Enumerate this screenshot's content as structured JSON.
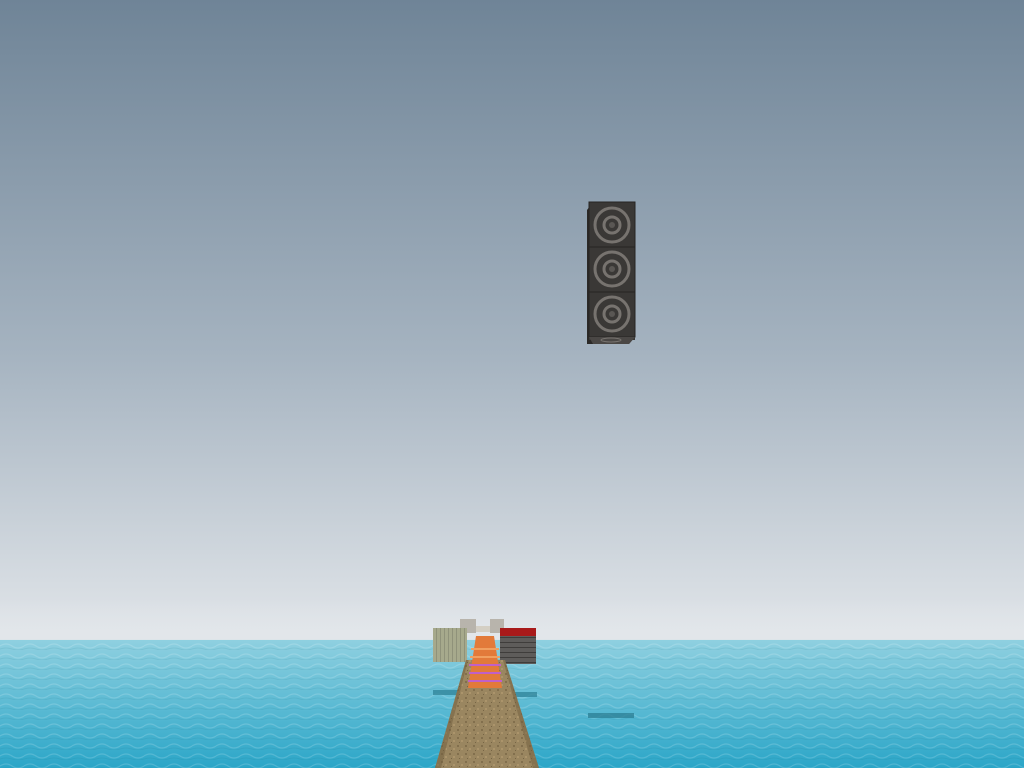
{
  "scene": {
    "colors": {
      "sky_top": "#6f8497",
      "sky_mid": "#a5b3c0",
      "sky_horizon": "#e2e6ea",
      "water_far": "#8fd0e0",
      "water_near": "#2ba6c8",
      "water_shadow": "#2b7d93",
      "path_dirt": "#9a8660",
      "path_dirt_dark": "#7c6a48",
      "speaker_block_dark": "#3a3836",
      "speaker_block_light": "#5a5754",
      "speaker_ring": "#77736f",
      "sandstone_block": "#a6a98c",
      "red_block_top": "#a81a1a",
      "grey_block": "#5e5c5a",
      "stone_pillar": "#b8b4ac",
      "orange_path": "#e27a3a",
      "magenta_path": "#c060c8"
    },
    "floating_object_icon": "note-block-stack-icon",
    "path_icon": "dirt-path-icon"
  }
}
